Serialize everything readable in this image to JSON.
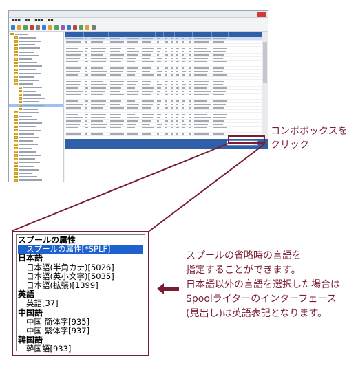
{
  "callout_combo": [
    "コンボボックスを",
    "クリック"
  ],
  "dropdown": {
    "groups": [
      {
        "label": "スプールの属性",
        "items": [
          {
            "label": "スプールの属性[*SPLF]",
            "selected": true
          }
        ]
      },
      {
        "label": "日本語",
        "items": [
          {
            "label": "日本語(半角カナ)[5026]",
            "selected": false
          },
          {
            "label": "日本語(英小文字)[5035]",
            "selected": false
          },
          {
            "label": "日本語(拡張)[1399]",
            "selected": false
          }
        ]
      },
      {
        "label": "英語",
        "items": [
          {
            "label": "英語[37]",
            "selected": false
          }
        ]
      },
      {
        "label": "中国語",
        "items": [
          {
            "label": "中国 簡体字[935]",
            "selected": false
          },
          {
            "label": "中国 繁体字[937]",
            "selected": false
          }
        ]
      },
      {
        "label": "韓国語",
        "items": [
          {
            "label": "韓国語[933]",
            "selected": false
          }
        ]
      }
    ]
  },
  "description": [
    "スプールの省略時の言語を",
    "指定することができます。",
    "日本語以外の言語を選択した場合は",
    "Spoolライターのインターフェース",
    "(見出し)は英語表記となります。"
  ],
  "colors": {
    "accent": "#7a1c32",
    "selection": "#1e62d0",
    "grid_header": "#2f5fa8"
  }
}
